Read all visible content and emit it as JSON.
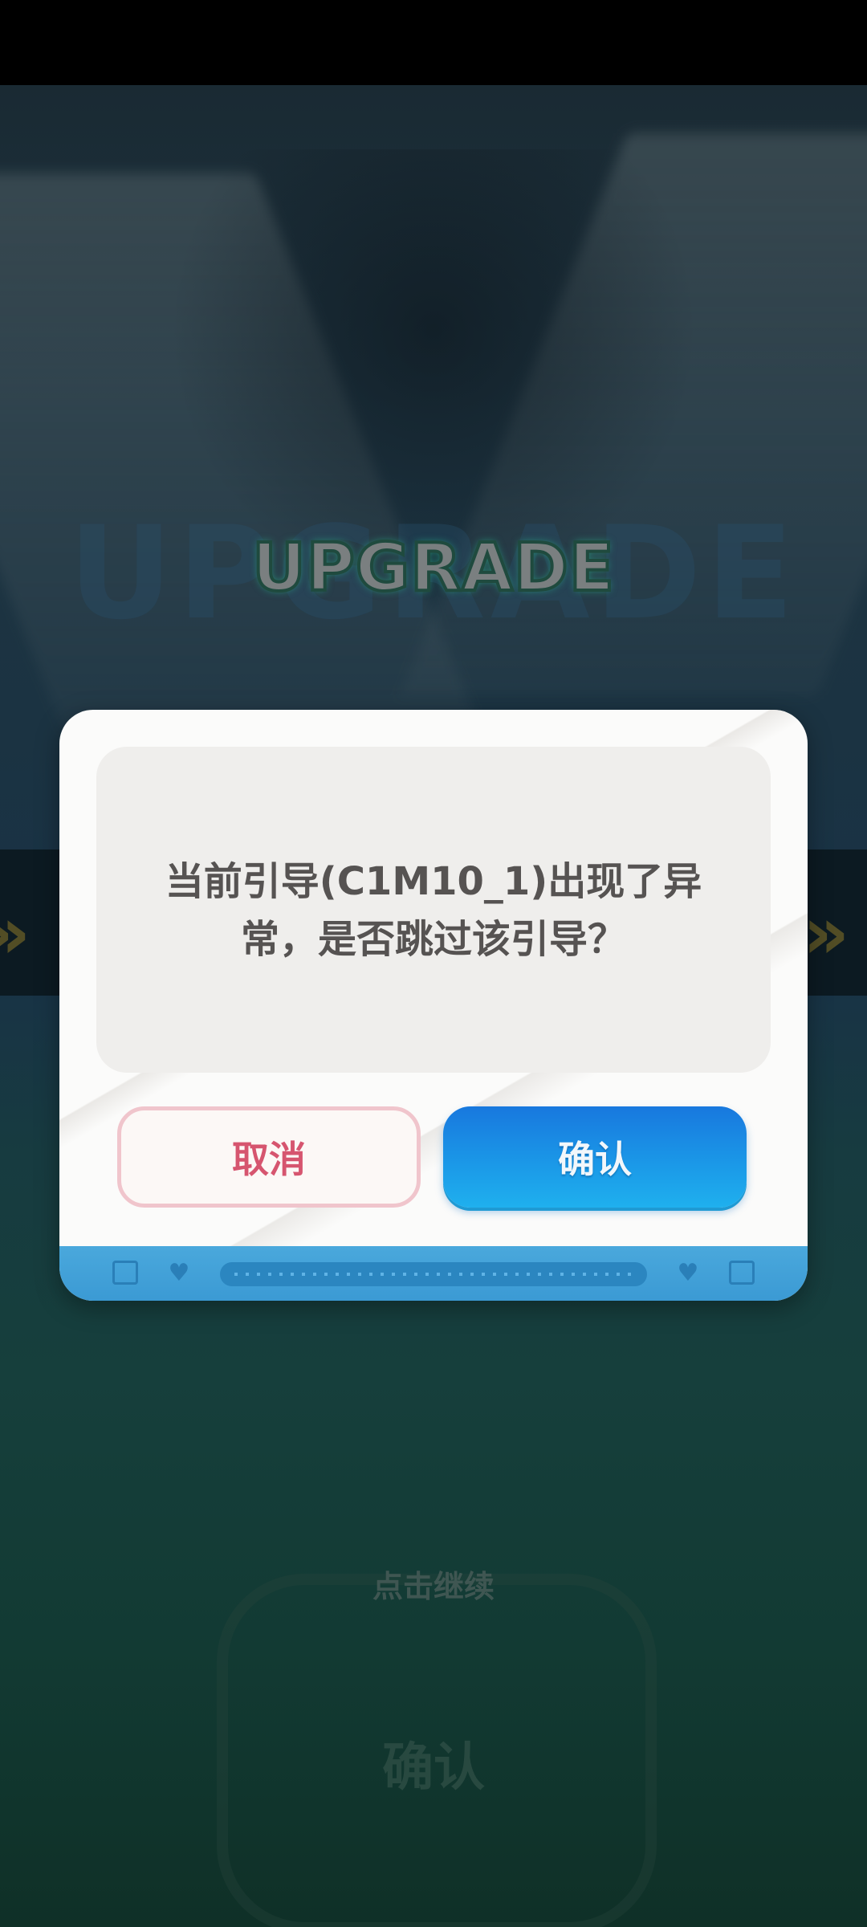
{
  "background": {
    "title": "UPGRADE",
    "continue_hint": "点击继续",
    "ghost_confirm": "确认"
  },
  "dialog": {
    "message": "当前引导(C1M10_1)出现了异常，是否跳过该引导？",
    "cancel_label": "取消",
    "confirm_label": "确认",
    "footer_icons": [
      "battery-icon",
      "heart-icon",
      "heart-icon",
      "battery-icon"
    ]
  },
  "colors": {
    "cancel_text": "#d6556f",
    "confirm_bg": "#1b9ae8",
    "footer": "#4aa8dc"
  }
}
